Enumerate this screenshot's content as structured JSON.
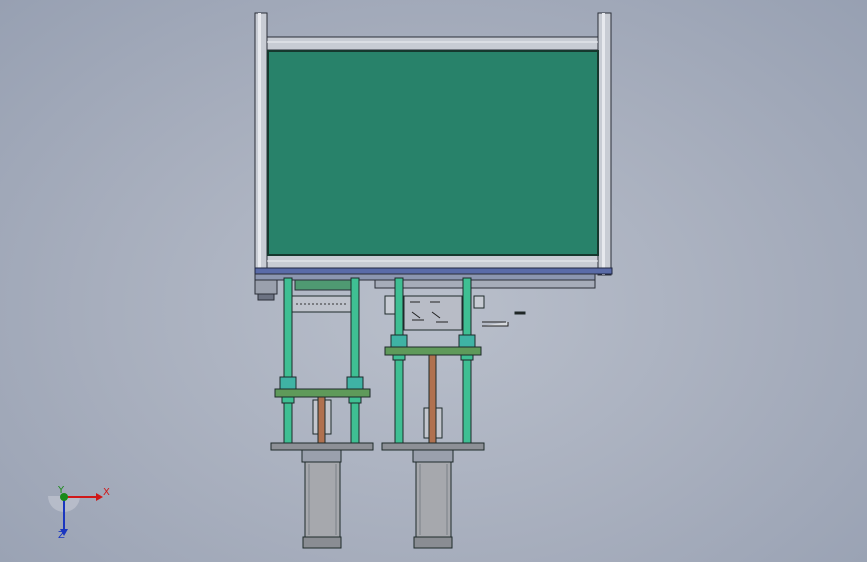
{
  "viewport": {
    "background_top": "#b9bfcb",
    "background_edge": "#97a0b2"
  },
  "colors": {
    "glass_panel": "#28826a",
    "frame_silver": "#c8ccd4",
    "frame_outline": "#2a2e38",
    "guide_rod": "#3fbf93",
    "mount_plate": "#5f9a5a",
    "piston_rod": "#b0714f",
    "cylinder_body": "#a6a8ad",
    "base_plate": "#8d9096",
    "top_rail": "#5a6ba8"
  },
  "triad": {
    "x_label": "X",
    "y_label": "Y",
    "z_label": "Z",
    "x_color": "#d01818",
    "y_color": "#1a8a1a",
    "z_color": "#1a36c0"
  }
}
